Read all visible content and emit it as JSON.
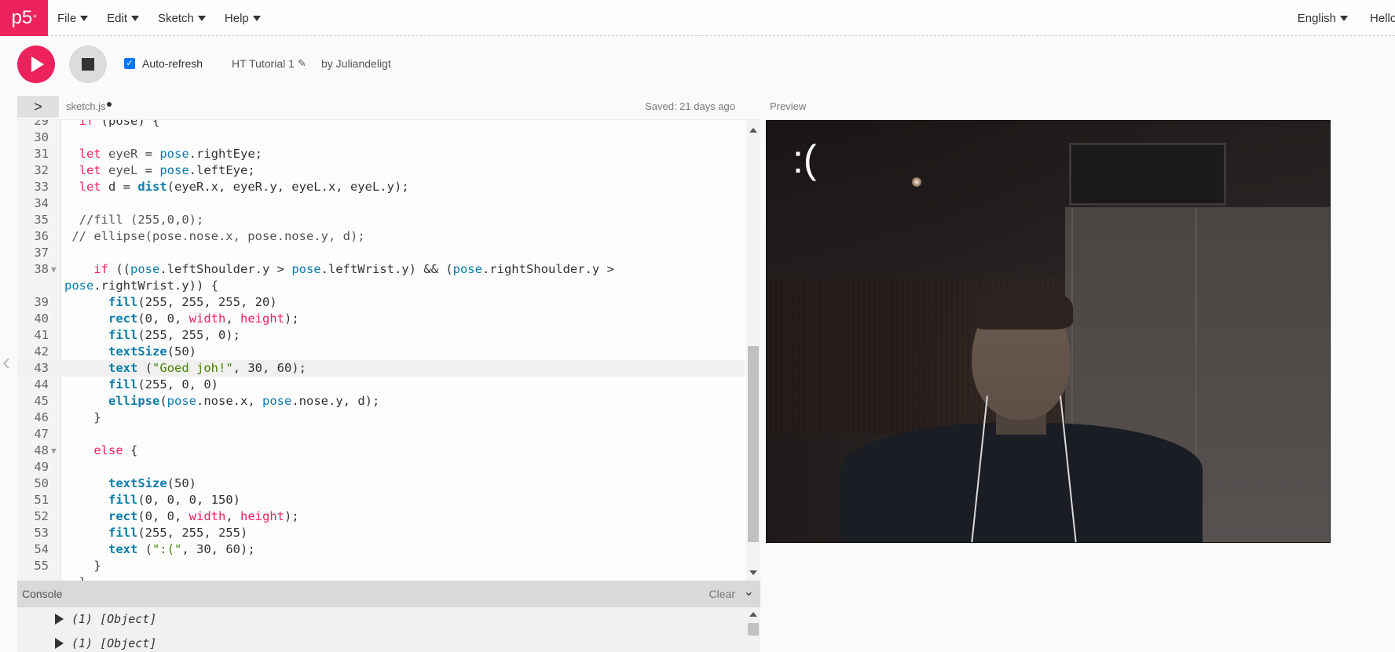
{
  "nav": {
    "logo": "p5",
    "logo_sup": "*",
    "menus": [
      {
        "label": "File"
      },
      {
        "label": "Edit"
      },
      {
        "label": "Sketch"
      },
      {
        "label": "Help"
      }
    ],
    "language": "English",
    "user_greeting": "Hello"
  },
  "toolbar": {
    "auto_refresh_label": "Auto-refresh",
    "auto_refresh_checked": true,
    "project_name": "HT Tutorial 1",
    "author": "by Juliandeligt"
  },
  "editor": {
    "file_tab": "sketch.js",
    "saved_status": "Saved: 21 days ago",
    "active_line": "43"
  },
  "preview": {
    "label": "Preview",
    "overlay_text": ":("
  },
  "console": {
    "title": "Console",
    "clear_label": "Clear",
    "entries": [
      {
        "count": "(1)",
        "text": "[Object]"
      },
      {
        "count": "(1)",
        "text": "[Object]"
      }
    ]
  },
  "colors": {
    "accent": "#ed225d",
    "keyword": "#ed225d",
    "function": "#0b7ca9",
    "string": "#47820a"
  }
}
